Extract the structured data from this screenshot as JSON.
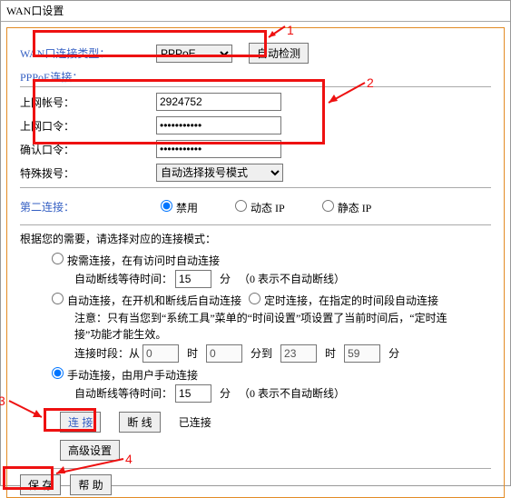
{
  "window": {
    "title": "WAN口设置"
  },
  "wan": {
    "type_label": "WAN口连接类型：",
    "type_value": "PPPoE",
    "autodetect": "自动检测"
  },
  "pppoe": {
    "header": "PPPoE连接：",
    "account_label": "上网帐号：",
    "account_value": "2924752",
    "pwd_label": "上网口令：",
    "pwd_value": "•••••••••••",
    "confirm_label": "确认口令：",
    "confirm_value": "•••••••••••"
  },
  "special_dial": {
    "label": "特殊拨号：",
    "value": "自动选择拨号模式"
  },
  "second_conn": {
    "label": "第二连接：",
    "disable": "禁用",
    "dyn": "动态 IP",
    "stat": "静态 IP"
  },
  "mode": {
    "intro": "根据您的需要，请选择对应的连接模式：",
    "ondemand": "按需连接，在有访问时自动连接",
    "auto_disconnect_wait": "自动断线等待时间：",
    "minutes": "分",
    "zero_note": "（0 表示不自动断线）",
    "autoconn": "自动连接，在开机和断线后自动连接",
    "timed": "定时连接，在指定的时间段自动连接",
    "timed_note": "注意：只有当您到“系统工具”菜单的“时间设置”项设置了当前时间后，“定时连接”功能才能生效。",
    "period": "连接时段：从",
    "hour": "时",
    "to": "分到",
    "period_from_h": "0",
    "period_from_m": "0",
    "period_to_h": "23",
    "period_to_m": "59",
    "manual": "手动连接，由用户手动连接",
    "wait_val": "15"
  },
  "conn": {
    "connect": "连 接",
    "disconnect": "断 线",
    "status": "已连接"
  },
  "adv": {
    "label": "高级设置"
  },
  "footer": {
    "save": "保 存",
    "help": "帮 助"
  },
  "annotations": {
    "a1": "1",
    "a2": "2",
    "a3": "3",
    "a4": "4"
  }
}
